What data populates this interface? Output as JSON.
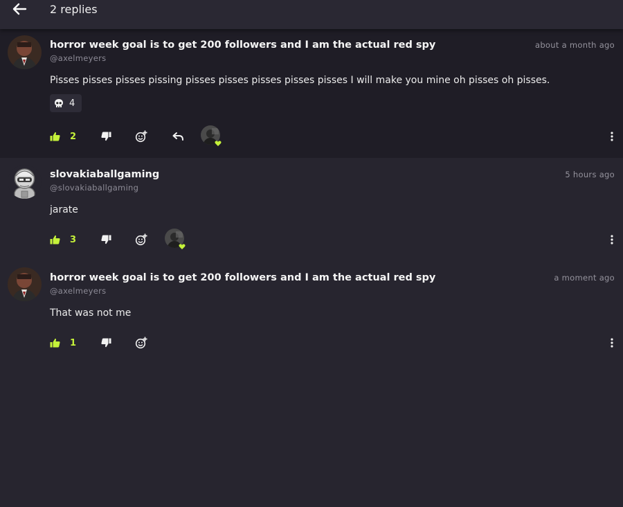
{
  "header": {
    "title": "2 replies"
  },
  "comments": [
    {
      "author": "horror week goal is to get 200 followers and I am the actual red spy",
      "handle": "@axelmeyers",
      "time": "about a month ago",
      "text": "Pisses pisses pisses pissing pisses pisses pisses pisses pisses I will make you mine oh pisses oh pisses.",
      "reaction": {
        "icon": "skull-icon",
        "count": "4"
      },
      "likes": "2",
      "has_reply": true,
      "has_liked_by": true
    },
    {
      "author": "slovakiaballgaming",
      "handle": "@slovakiaballgaming",
      "time": "5 hours ago",
      "text": "jarate",
      "likes": "3",
      "has_reply": false,
      "has_liked_by": true
    },
    {
      "author": "horror week goal is to get 200 followers and I am the actual red spy",
      "handle": "@axelmeyers",
      "time": "a moment ago",
      "text": "That was not me",
      "likes": "1",
      "has_reply": false,
      "has_liked_by": false
    }
  ],
  "colors": {
    "accent": "#c5f23a",
    "background": "#27252f",
    "highlight_bg": "#1f1d26"
  }
}
